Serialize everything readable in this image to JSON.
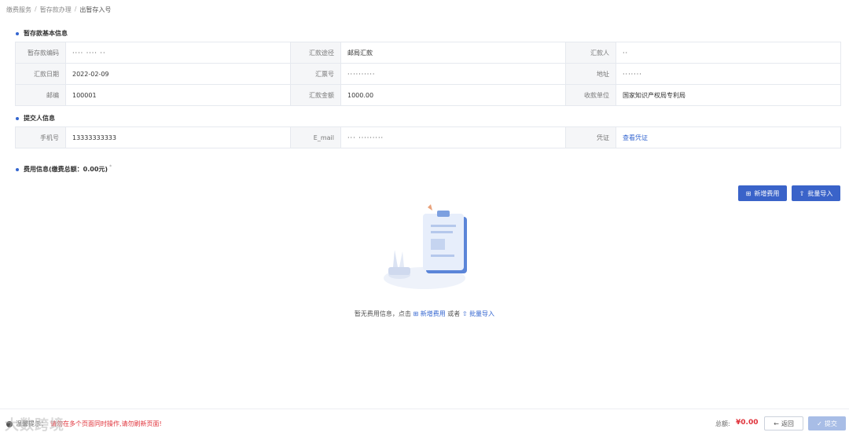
{
  "breadcrumb": [
    "缴费服务",
    "暂存款办理",
    "出暂存入号"
  ],
  "sections": {
    "basic_title": "暂存款基本信息",
    "submitter_title": "提交人信息",
    "fee_title": "费用信息(缴费总额：0.00元)",
    "fee_title_sup": "*"
  },
  "basic": {
    "rows": [
      [
        {
          "label": "暂存款编码",
          "value": "···· ···· ··"
        },
        {
          "label": "汇款途径",
          "value": "邮局汇款"
        },
        {
          "label": "汇款人",
          "value": "··"
        }
      ],
      [
        {
          "label": "汇款日期",
          "value": "2022-02-09"
        },
        {
          "label": "汇票号",
          "value": "··········"
        },
        {
          "label": "地址",
          "value": "·······"
        }
      ],
      [
        {
          "label": "邮编",
          "value": "100001"
        },
        {
          "label": "汇款金额",
          "value": "1000.00"
        },
        {
          "label": "收款单位",
          "value": "国家知识产权局专利局"
        }
      ]
    ]
  },
  "submitter": {
    "phone_label": "手机号",
    "phone_value": "13333333333",
    "email_label": "E_mail",
    "email_value": "··· ·········",
    "voucher_label": "凭证",
    "voucher_link": "查看凭证"
  },
  "actions": {
    "add_fee": "新增费用",
    "batch_import": "批量导入"
  },
  "empty": {
    "prefix": "暂无费用信息，点击",
    "add_link": "新增费用",
    "middle": "或者",
    "import_link": "批量导入"
  },
  "footer": {
    "hint_prefix": "温馨提示：",
    "hint_warn": "请勿在多个页面同时操作,请勿刷新页面!",
    "watermark": "大数跨境",
    "total_label": "总额:",
    "total_value": "¥0.00",
    "back_label": "返回",
    "submit_label": "提交"
  },
  "colors": {
    "primary": "#3a63c9",
    "link": "#3466d0",
    "danger": "#e0323a",
    "submit_disabled": "#a8bde6"
  }
}
